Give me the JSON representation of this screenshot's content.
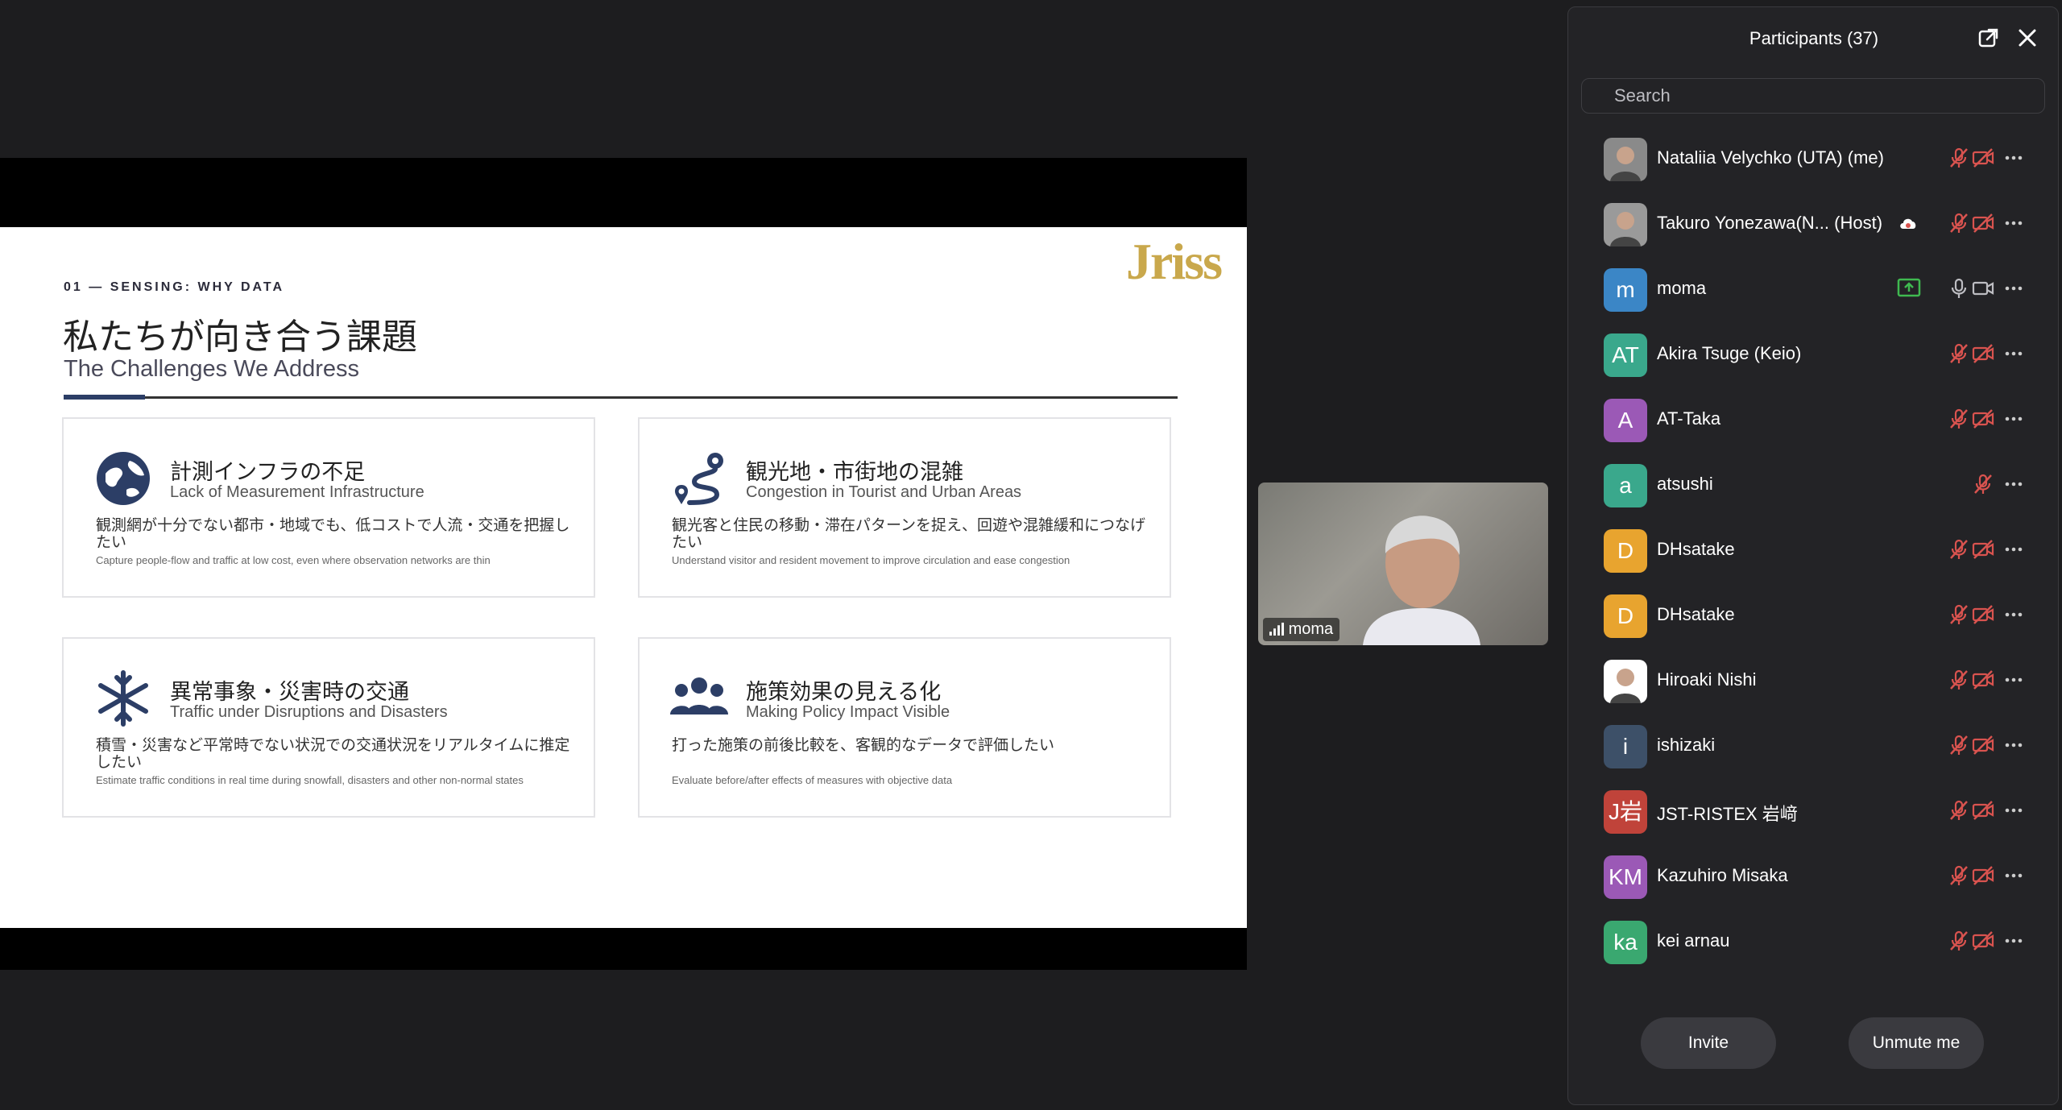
{
  "slide": {
    "kicker": "01 — SENSING: WHY DATA",
    "logo": "Jriss",
    "title_jp": "私たちが向き合う課題",
    "title_en": "The Challenges We Address",
    "cards": [
      {
        "icon": "globe-icon",
        "jp": "計測インフラの不足",
        "en": "Lack of Measurement Infrastructure",
        "desc": "観測網が十分でない都市・地域でも、低コストで人流・交通を把握したい",
        "small": "Capture people-flow and traffic at low cost, even where observation networks are thin"
      },
      {
        "icon": "route-icon",
        "jp": "観光地・市街地の混雑",
        "en": "Congestion in Tourist and Urban Areas",
        "desc": "観光客と住民の移動・滞在パターンを捉え、回遊や混雑緩和につなげたい",
        "small": "Understand visitor and resident movement to improve circulation and ease congestion"
      },
      {
        "icon": "snowflake-icon",
        "jp": "異常事象・災害時の交通",
        "en": "Traffic under Disruptions and Disasters",
        "desc": "積雪・災害など平常時でない状況での交通状況をリアルタイムに推定したい",
        "small": "Estimate traffic conditions in real time during snowfall, disasters and other non-normal states"
      },
      {
        "icon": "people-group-icon",
        "jp": "施策効果の見える化",
        "en": "Making Policy Impact Visible",
        "desc": "打った施策の前後比較を、客観的なデータで評価したい",
        "small": "Evaluate before/after effects of measures with objective data"
      }
    ]
  },
  "video": {
    "label": "moma"
  },
  "panel": {
    "title": "Participants (37)",
    "search_placeholder": "Search",
    "participants": [
      {
        "name": "Nataliia Velychko (UTA) (me)",
        "initials": "",
        "color": "#8a8a8a",
        "mic": "muted",
        "cam": "off"
      },
      {
        "name": "Takuro Yonezawa(N... (Host)",
        "initials": "",
        "color": "#9a9a9a",
        "mic": "muted",
        "cam": "off"
      },
      {
        "name": "moma",
        "initials": "m",
        "color": "#3b86c6",
        "mic": "on",
        "cam": "on"
      },
      {
        "name": "Akira Tsuge (Keio)",
        "initials": "AT",
        "color": "#3aa88c",
        "mic": "muted",
        "cam": "off"
      },
      {
        "name": "AT-Taka",
        "initials": "A",
        "color": "#9b59b6",
        "mic": "muted",
        "cam": "off"
      },
      {
        "name": "atsushi",
        "initials": "a",
        "color": "#3aa88c",
        "mic": "muted",
        "cam": "none"
      },
      {
        "name": "DHsatake",
        "initials": "D",
        "color": "#e8a42f",
        "mic": "muted",
        "cam": "off"
      },
      {
        "name": "DHsatake",
        "initials": "D",
        "color": "#e8a42f",
        "mic": "muted",
        "cam": "off"
      },
      {
        "name": "Hiroaki Nishi",
        "initials": "",
        "color": "#ffffff",
        "mic": "muted",
        "cam": "off"
      },
      {
        "name": "ishizaki",
        "initials": "i",
        "color": "#3d5068",
        "mic": "muted",
        "cam": "off"
      },
      {
        "name": "JST-RISTEX 岩﨑",
        "initials": "J岩",
        "color": "#c0433a",
        "mic": "muted",
        "cam": "off"
      },
      {
        "name": "Kazuhiro Misaka",
        "initials": "KM",
        "color": "#9b59b6",
        "mic": "muted",
        "cam": "off"
      },
      {
        "name": "kei arnau",
        "initials": "ka",
        "color": "#3aa870",
        "mic": "muted",
        "cam": "off"
      }
    ],
    "invite_label": "Invite",
    "unmute_label": "Unmute me"
  },
  "colors": {
    "muted_icon": "#d9534f",
    "accent": "#2c3e66",
    "logo": "#c9a84c"
  }
}
